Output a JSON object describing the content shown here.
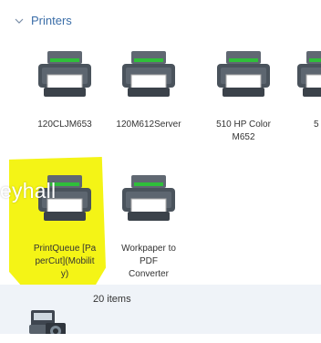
{
  "group": {
    "title": "Printers",
    "chevron_icon": "chevron-down-icon"
  },
  "printers": [
    {
      "name": "120CLJM653",
      "icon": "printer-icon"
    },
    {
      "name": "120M612Server",
      "icon": "printer-icon"
    },
    {
      "name": "510 HP Color M652",
      "icon": "printer-icon"
    },
    {
      "name": "5",
      "icon": "printer-icon"
    },
    {
      "name": "PrintQueue [PaperCut](Mobility)",
      "icon": "printer-icon"
    },
    {
      "name": "Workpaper to PDF Converter",
      "icon": "printer-icon"
    }
  ],
  "overlay": {
    "text": "eyhall",
    "highlight_color": "#f4f416"
  },
  "status": {
    "count": "20 items",
    "icon": "devices-icon"
  },
  "colors": {
    "accent": "#3b6ea8",
    "status_bg": "#eff3f8",
    "printer_green": "#2fbf3a"
  }
}
